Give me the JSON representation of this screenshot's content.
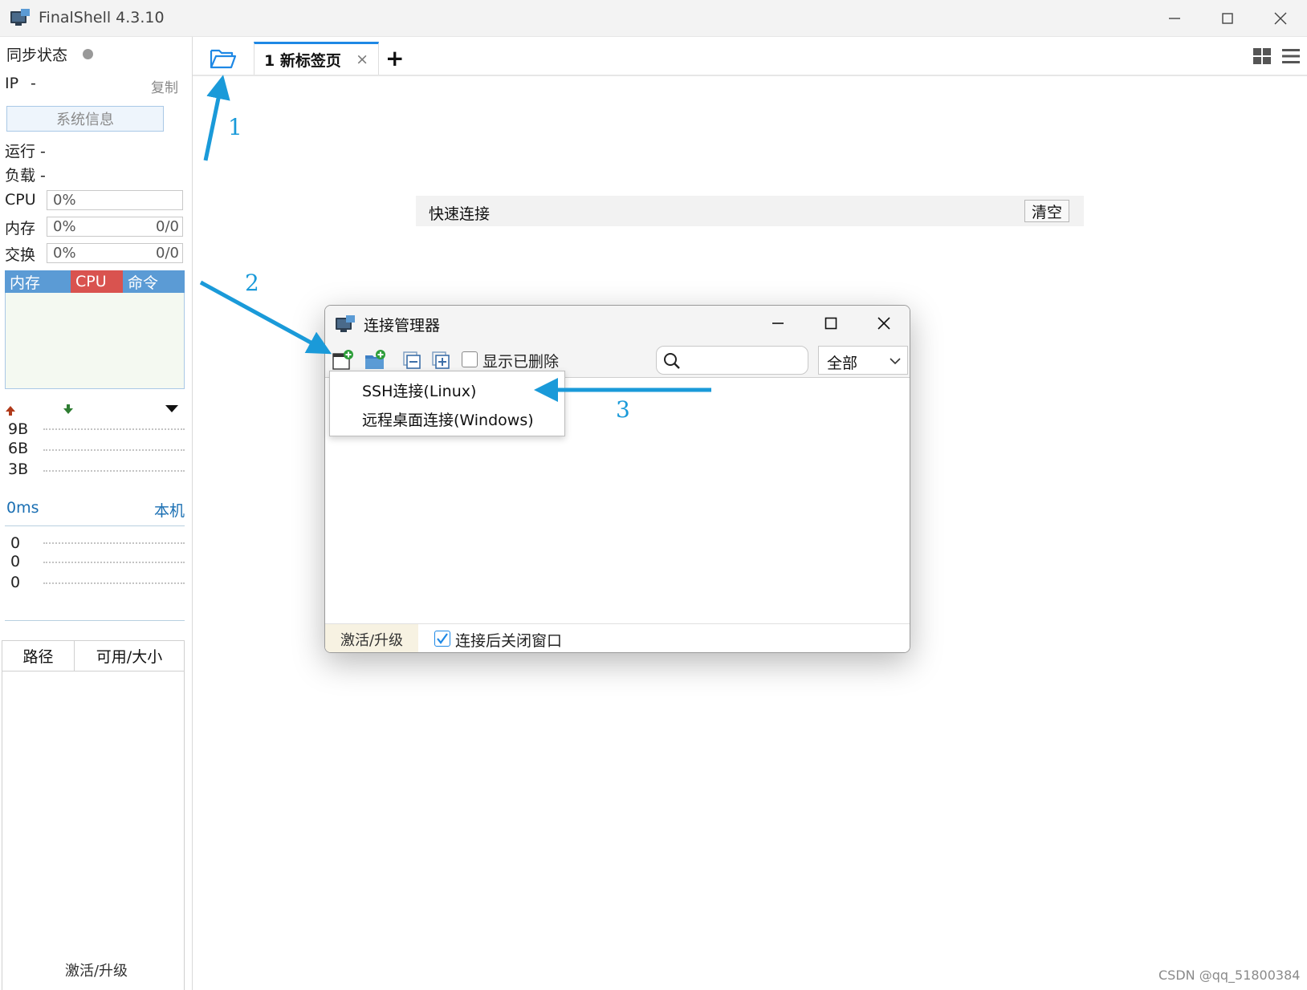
{
  "window": {
    "title": "FinalShell 4.3.10",
    "minimize_icon": "minimize-icon",
    "maximize_icon": "maximize-icon",
    "close_icon": "close-icon"
  },
  "sidebar": {
    "sync_label": "同步状态",
    "ip_label": "IP",
    "ip_value": "-",
    "copy_label": "复制",
    "sysinfo_button": "系统信息",
    "run_label": "运行 -",
    "load_label": "负载 -",
    "cpu": {
      "label": "CPU",
      "percent": "0%"
    },
    "memory": {
      "label": "内存",
      "percent": "0%",
      "usage": "0/0"
    },
    "swap": {
      "label": "交换",
      "percent": "0%",
      "usage": "0/0"
    },
    "monitor_tabs": [
      {
        "label": "内存",
        "color": "#5b9bd5"
      },
      {
        "label": "CPU",
        "color": "#d9534f"
      },
      {
        "label": "命令",
        "color": "#5b9bd5"
      }
    ],
    "network": {
      "ticks": [
        "9B",
        "6B",
        "3B"
      ]
    },
    "ping": {
      "latency": "0ms",
      "host": "本机",
      "values": [
        "0",
        "0",
        "0"
      ]
    },
    "fs_columns": [
      "路径",
      "可用/大小"
    ],
    "activate": "激活/升级"
  },
  "main": {
    "tab_label": "1 新标签页",
    "tab_close": "×",
    "add_tab": "+",
    "quick_connect": {
      "label": "快速连接",
      "clear_button": "清空"
    }
  },
  "dialog": {
    "title": "连接管理器",
    "show_deleted_label": "显示已删除",
    "filter_value": "全部",
    "menu_items": [
      "SSH连接(Linux)",
      "远程桌面连接(Windows)"
    ],
    "footer": {
      "activate": "激活/升级",
      "close_after_connect": "连接后关闭窗口"
    }
  },
  "annotations": {
    "labels": [
      "1",
      "2",
      "3"
    ],
    "color": "#1a9ad9"
  },
  "watermark": "CSDN @qq_51800384"
}
